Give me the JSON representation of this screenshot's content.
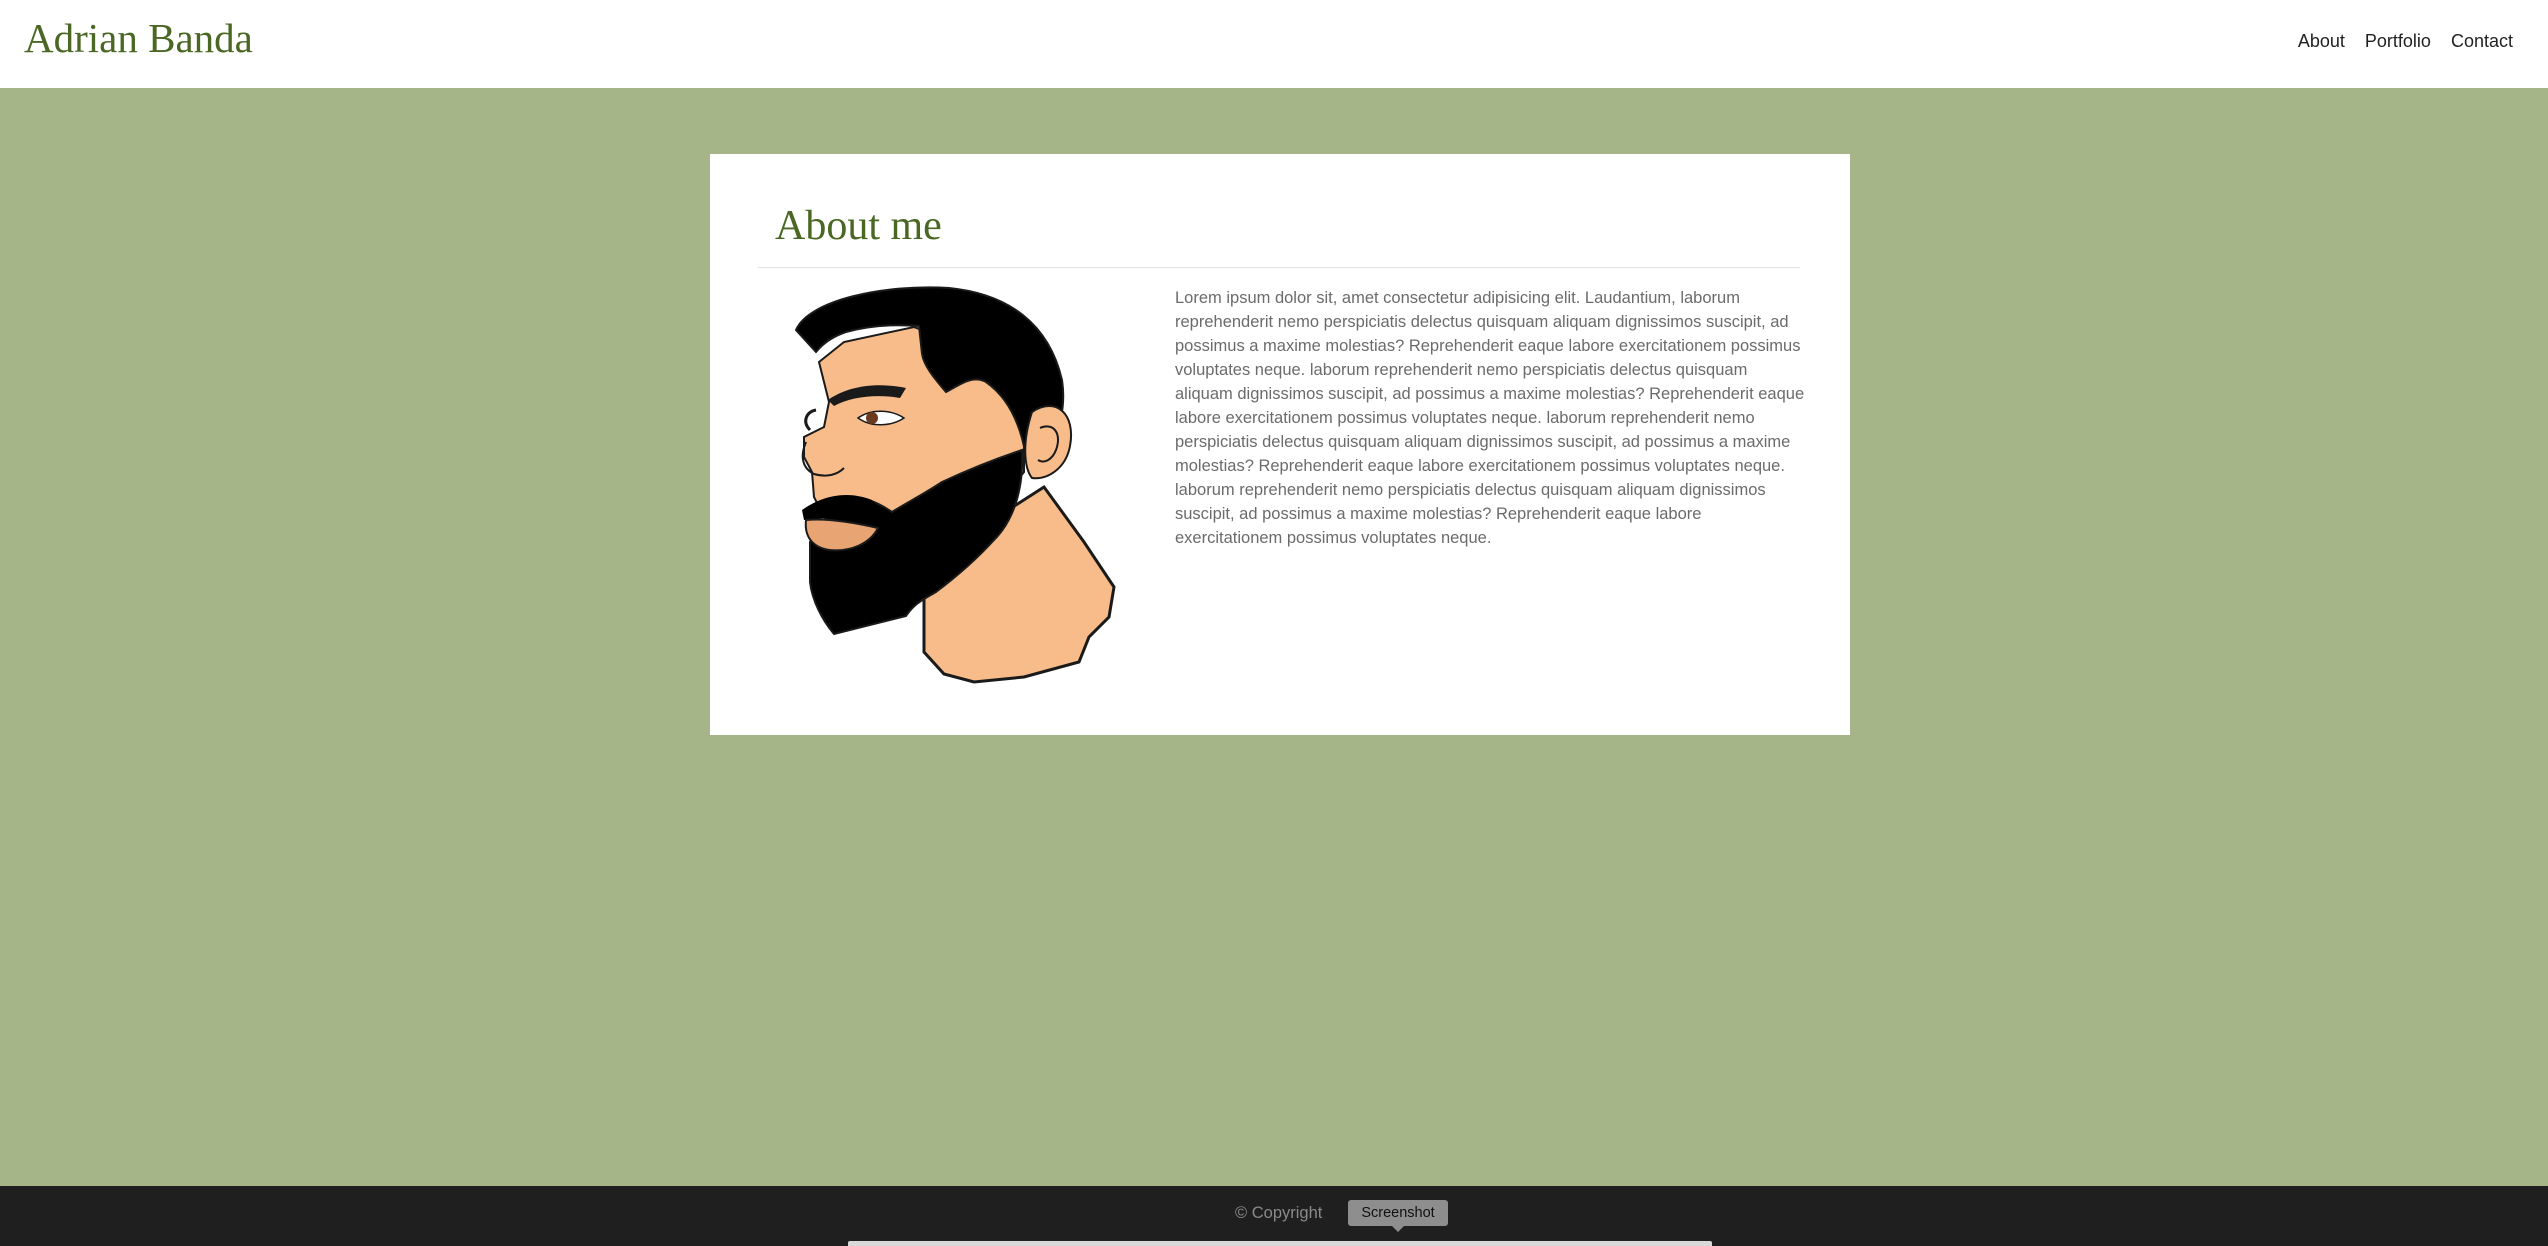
{
  "header": {
    "brand": "Adrian Banda",
    "nav": {
      "about": "About",
      "portfolio": "Portfolio",
      "contact": "Contact"
    }
  },
  "about": {
    "title": "About me",
    "image_alt": "cartoon-man-with-beard-portrait",
    "text": "Lorem ipsum dolor sit, amet consectetur adipisicing elit. Laudantium, laborum reprehenderit nemo perspiciatis delectus quisquam aliquam dignissimos suscipit, ad possimus a maxime molestias? Reprehenderit eaque labore exercitationem possimus voluptates neque. laborum reprehenderit nemo perspiciatis delectus quisquam aliquam dignissimos suscipit, ad possimus a maxime molestias? Reprehenderit eaque labore exercitationem possimus voluptates neque. laborum reprehenderit nemo perspiciatis delectus quisquam aliquam dignissimos suscipit, ad possimus a maxime molestias? Reprehenderit eaque labore exercitationem possimus voluptates neque. laborum reprehenderit nemo perspiciatis delectus quisquam aliquam dignissimos suscipit, ad possimus a maxime molestias? Reprehenderit eaque labore exercitationem possimus voluptates neque."
  },
  "footer": {
    "copyright": "© Copyright",
    "tooltip": "Screenshot"
  },
  "colors": {
    "page_background": "#a6b587",
    "brand_green": "#4a6724",
    "footer_background": "#1f1f1f",
    "skin": "#f7bc8a",
    "hair": "#000000"
  }
}
